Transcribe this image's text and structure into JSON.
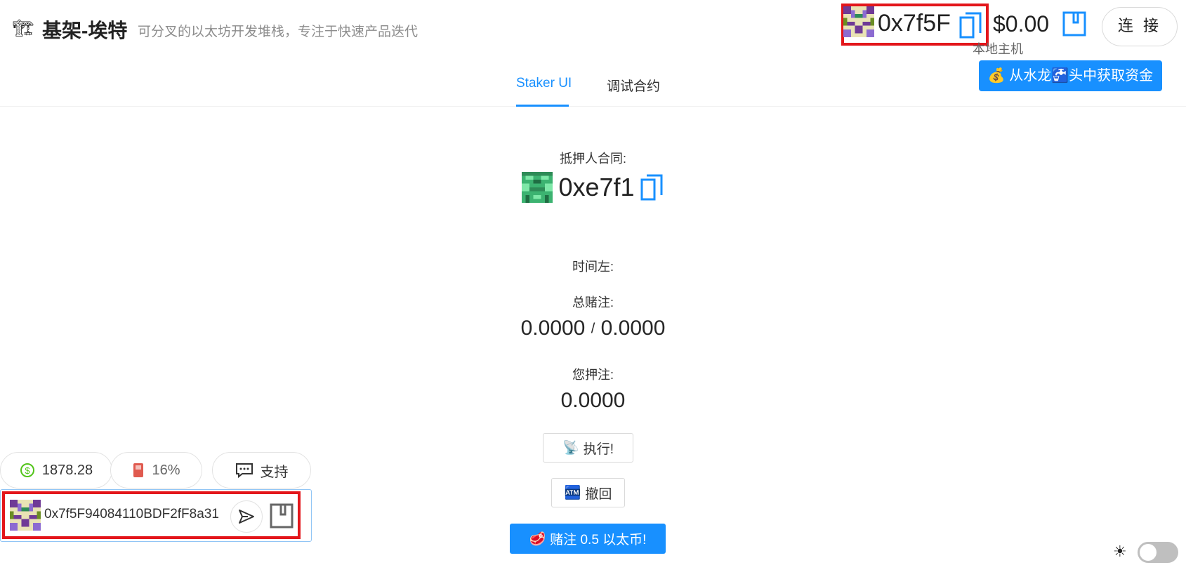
{
  "header": {
    "logo_icon": "🏗",
    "title": "基架-埃特",
    "subtitle": "可分叉的以太坊开发堆栈，专注于快速产品迭代",
    "account_address": "0x7f5F",
    "balance": "$0.00",
    "network": "本地主机",
    "connect_label": "连 接",
    "faucet_label": "💰 从水龙🚰头中获取资金"
  },
  "tabs": [
    {
      "label": "Staker UI",
      "active": true
    },
    {
      "label": "调试合约",
      "active": false
    }
  ],
  "main": {
    "contract_label": "抵押人合同:",
    "contract_address": "0xe7f1",
    "time_left_label": "时间左:",
    "total_staked_label": "总赌注:",
    "total_staked": "0.0000",
    "threshold": "0.0000",
    "separator": "/",
    "you_staked_label": "您押注:",
    "you_staked": "0.0000",
    "execute_label": "执行!",
    "execute_icon": "📡",
    "withdraw_label": "撤回",
    "withdraw_icon": "🏧",
    "stake_label": "赌注 0.5 以太币!",
    "stake_icon": "🥩"
  },
  "bottom": {
    "price": "1878.28",
    "gas": "16%",
    "support_label": "支持",
    "wallet_address": "0x7f5F94084110BDF2fF8a31"
  },
  "colors": {
    "accent": "#1890ff",
    "highlight_box": "#e3161b"
  }
}
